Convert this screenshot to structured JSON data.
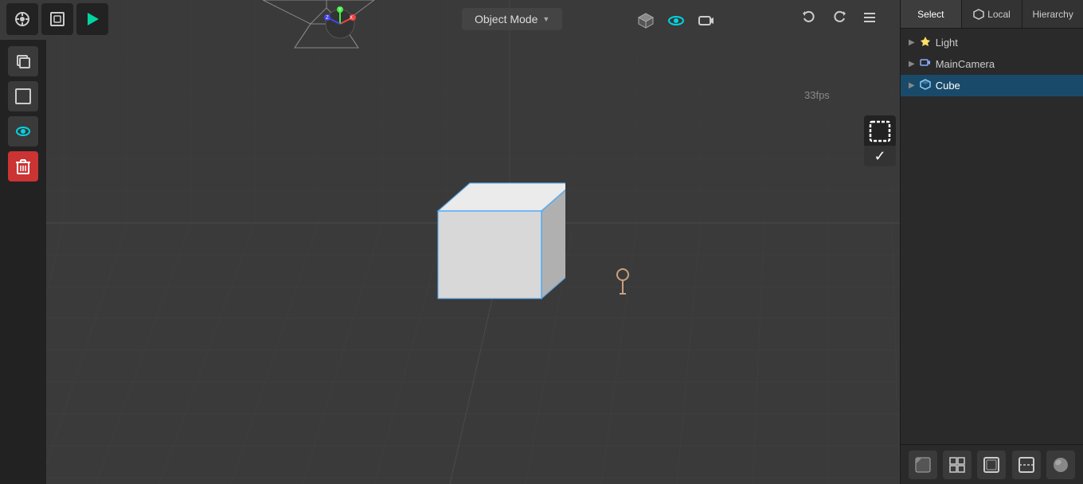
{
  "viewport": {
    "mode_label": "Object Mode",
    "fps": "33fps",
    "grid_color": "#444",
    "bg_color": "#3a3a3a"
  },
  "top_toolbar": {
    "blender_icon": "⬡",
    "local_view_icon": "◱",
    "play_icon": "▶",
    "refresh_icon": "↻",
    "move_icon": "✛"
  },
  "left_toolbar": {
    "copy_icon": "❐",
    "box_icon": "▢",
    "eye_icon": "👁",
    "trash_icon": "🗑"
  },
  "viewport_icons": {
    "perspective_label": "⬡",
    "view_label": "👁",
    "camera_label": "🎥"
  },
  "right_panel": {
    "tabs": [
      {
        "id": "select",
        "label": "Select",
        "active": true
      },
      {
        "id": "local",
        "label": "Local",
        "has_icon": true
      },
      {
        "id": "hierarchy",
        "label": "Hierarchy"
      }
    ],
    "scene_items": [
      {
        "id": "light",
        "label": "Light",
        "type": "light"
      },
      {
        "id": "main-camera",
        "label": "MainCamera",
        "type": "camera"
      },
      {
        "id": "cube",
        "label": "Cube",
        "type": "cube",
        "selected": true
      }
    ],
    "bottom_buttons": [
      "◧",
      "⊞",
      "◫",
      "◩",
      "●"
    ]
  }
}
